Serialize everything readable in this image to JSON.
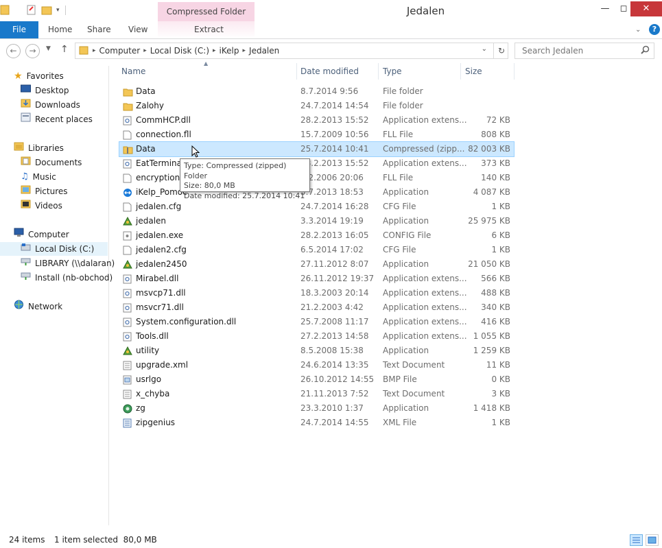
{
  "window": {
    "title": "Jedalen"
  },
  "ribbon": {
    "context_group": "Compressed Folder Tools",
    "tabs": {
      "file": "File",
      "home": "Home",
      "share": "Share",
      "view": "View",
      "extract": "Extract"
    }
  },
  "address": {
    "segments": [
      "Computer",
      "Local Disk (C:)",
      "iKelp",
      "Jedalen"
    ]
  },
  "search": {
    "placeholder": "Search Jedalen"
  },
  "nav": {
    "favorites": {
      "label": "Favorites",
      "items": [
        "Desktop",
        "Downloads",
        "Recent places"
      ]
    },
    "libraries": {
      "label": "Libraries",
      "items": [
        "Documents",
        "Music",
        "Pictures",
        "Videos"
      ]
    },
    "computer": {
      "label": "Computer",
      "items": [
        "Local Disk (C:)",
        "LIBRARY (\\\\dalaran)",
        "Install (nb-obchod)"
      ]
    },
    "network": {
      "label": "Network"
    }
  },
  "columns": {
    "name": "Name",
    "date": "Date modified",
    "type": "Type",
    "size": "Size"
  },
  "files": [
    {
      "name": "Data",
      "date": "8.7.2014 9:56",
      "type": "File folder",
      "size": "",
      "icon": "folder-icon"
    },
    {
      "name": "Zalohy",
      "date": "24.7.2014 14:54",
      "type": "File folder",
      "size": "",
      "icon": "folder-icon"
    },
    {
      "name": "CommHCP.dll",
      "date": "28.2.2013 15:52",
      "type": "Application extens...",
      "size": "72 KB",
      "icon": "dll-icon"
    },
    {
      "name": "connection.fll",
      "date": "15.7.2009 10:56",
      "type": "FLL File",
      "size": "808 KB",
      "icon": "file-icon"
    },
    {
      "name": "Data",
      "date": "25.7.2014 10:41",
      "type": "Compressed (zipp...",
      "size": "82 003 KB",
      "icon": "zip-folder-icon"
    },
    {
      "name": "EatTerminal",
      "date": "28.2.2013 15:52",
      "type": "Application extens...",
      "size": "373 KB",
      "icon": "dll-icon"
    },
    {
      "name": "encryption.fll",
      "date": "9.2.2006 20:06",
      "type": "FLL File",
      "size": "140 KB",
      "icon": "file-icon"
    },
    {
      "name": "iKelp_Pomoc",
      "date": "5.7.2013 18:53",
      "type": "Application",
      "size": "4 087 KB",
      "icon": "teamviewer-icon"
    },
    {
      "name": "jedalen.cfg",
      "date": "24.7.2014 16:28",
      "type": "CFG File",
      "size": "1 KB",
      "icon": "file-icon"
    },
    {
      "name": "jedalen",
      "date": "3.3.2014 19:19",
      "type": "Application",
      "size": "25 975 KB",
      "icon": "app-icon"
    },
    {
      "name": "jedalen.exe",
      "date": "28.2.2013 16:05",
      "type": "CONFIG File",
      "size": "6 KB",
      "icon": "config-icon"
    },
    {
      "name": "jedalen2.cfg",
      "date": "6.5.2014 17:02",
      "type": "CFG File",
      "size": "1 KB",
      "icon": "file-icon"
    },
    {
      "name": "jedalen2450",
      "date": "27.11.2012 8:07",
      "type": "Application",
      "size": "21 050 KB",
      "icon": "app-icon"
    },
    {
      "name": "Mirabel.dll",
      "date": "26.11.2012 19:37",
      "type": "Application extens...",
      "size": "566 KB",
      "icon": "dll-icon"
    },
    {
      "name": "msvcp71.dll",
      "date": "18.3.2003 20:14",
      "type": "Application extens...",
      "size": "488 KB",
      "icon": "dll-icon"
    },
    {
      "name": "msvcr71.dll",
      "date": "21.2.2003 4:42",
      "type": "Application extens...",
      "size": "340 KB",
      "icon": "dll-icon"
    },
    {
      "name": "System.configuration.dll",
      "date": "25.7.2008 11:17",
      "type": "Application extens...",
      "size": "416 KB",
      "icon": "dll-icon"
    },
    {
      "name": "Tools.dll",
      "date": "27.2.2013 14:58",
      "type": "Application extens...",
      "size": "1 055 KB",
      "icon": "dll-icon"
    },
    {
      "name": "utility",
      "date": "8.5.2008 15:38",
      "type": "Application",
      "size": "1 259 KB",
      "icon": "app-icon"
    },
    {
      "name": "upgrade.xml",
      "date": "24.6.2014 13:35",
      "type": "Text Document",
      "size": "11 KB",
      "icon": "text-icon"
    },
    {
      "name": "usrlgo",
      "date": "26.10.2012 14:55",
      "type": "BMP File",
      "size": "0 KB",
      "icon": "bmp-icon"
    },
    {
      "name": "x_chyba",
      "date": "21.11.2013 7:52",
      "type": "Text Document",
      "size": "3 KB",
      "icon": "text-icon"
    },
    {
      "name": "zg",
      "date": "23.3.2010 1:37",
      "type": "Application",
      "size": "1 418 KB",
      "icon": "zg-icon"
    },
    {
      "name": "zipgenius",
      "date": "24.7.2014 14:55",
      "type": "XML File",
      "size": "1 KB",
      "icon": "xml-icon"
    }
  ],
  "selected_index": 4,
  "tooltip": {
    "type_line": "Type: Compressed (zipped) Folder",
    "size_line": "Size: 80,0 MB",
    "date_line": "Date modified: 25.7.2014 10:41"
  },
  "status": {
    "items_count": "24 items",
    "selection": "1 item selected  80,0 MB"
  },
  "colors": {
    "file_tab": "#1979ca",
    "context_tab": "#f7d5e4",
    "selection": "#cce8ff",
    "close_button": "#c7373a"
  }
}
